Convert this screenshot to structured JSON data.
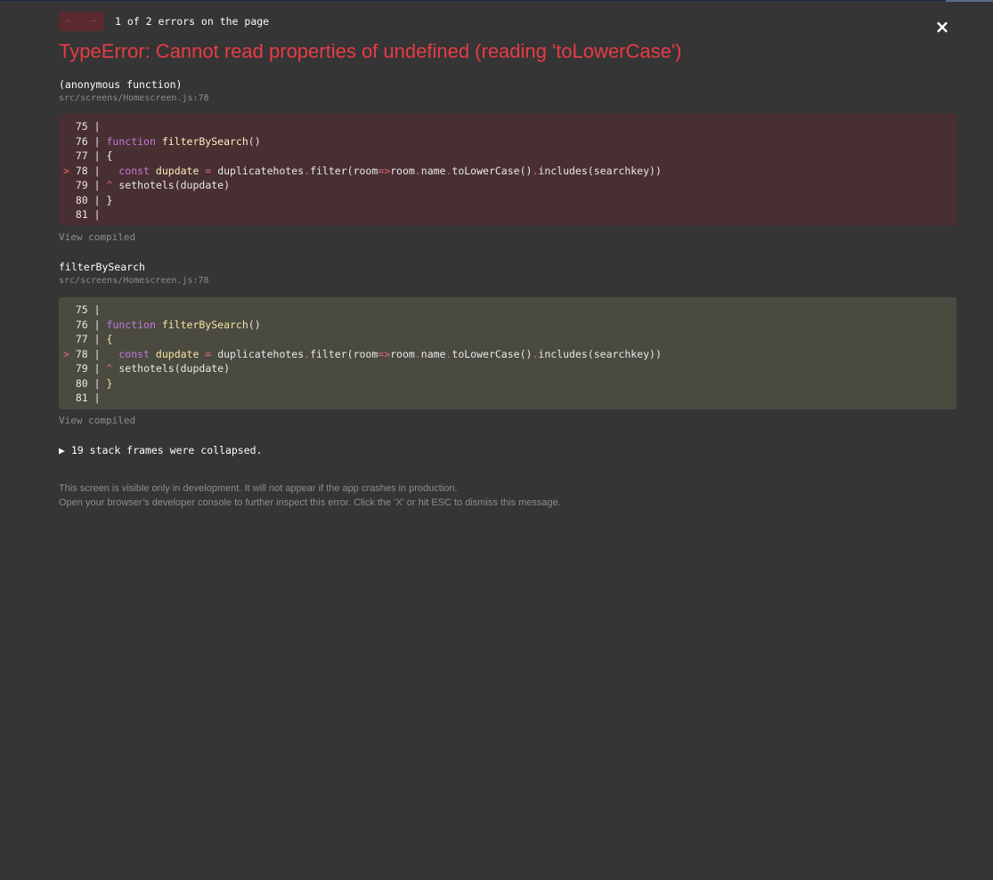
{
  "nav": {
    "prev_icon": "←",
    "next_icon": "→",
    "counter_text": "1 of 2 errors on the page"
  },
  "close": {
    "icon": "×"
  },
  "error": {
    "title": "TypeError: Cannot read properties of undefined (reading 'toLowerCase')"
  },
  "frames": [
    {
      "name": "(anonymous function)",
      "file": "src/screens/Homescreen.js:78",
      "view_compiled": "View compiled",
      "lines": [
        {
          "marker": " ",
          "number": "75",
          "code": ""
        },
        {
          "marker": " ",
          "number": "76",
          "code": "function filterBySearch()"
        },
        {
          "marker": " ",
          "number": "77",
          "code": "{"
        },
        {
          "marker": ">",
          "number": "78",
          "code": "  const dupdate = duplicatehotes.filter(room=>room.name.toLowerCase().includes(searchkey))"
        },
        {
          "marker": " ",
          "number": "79",
          "code": "^ sethotels(dupdate)"
        },
        {
          "marker": " ",
          "number": "80",
          "code": "}"
        },
        {
          "marker": " ",
          "number": "81",
          "code": ""
        }
      ]
    },
    {
      "name": "filterBySearch",
      "file": "src/screens/Homescreen.js:78",
      "view_compiled": "View compiled",
      "lines": [
        {
          "marker": " ",
          "number": "75",
          "code": ""
        },
        {
          "marker": " ",
          "number": "76",
          "code": "function filterBySearch()"
        },
        {
          "marker": " ",
          "number": "77",
          "code": "{"
        },
        {
          "marker": ">",
          "number": "78",
          "code": "  const dupdate = duplicatehotes.filter(room=>room.name.toLowerCase().includes(searchkey))"
        },
        {
          "marker": " ",
          "number": "79",
          "code": "^ sethotels(dupdate)"
        },
        {
          "marker": " ",
          "number": "80",
          "code": "}"
        },
        {
          "marker": " ",
          "number": "81",
          "code": ""
        }
      ]
    }
  ],
  "collapsed": {
    "arrow": "▶",
    "text": "19 stack frames were collapsed."
  },
  "footer": {
    "line1": "This screen is visible only in development. It will not appear if the app crashes in production.",
    "line2": "Open your browser’s developer console to further inspect this error.  Click the 'X' or hit ESC to dismiss this message."
  },
  "colors": {
    "background": "#353535",
    "error_red": "#e83b46",
    "code_bg_red": "#482f31",
    "code_bg_yellow": "#4a4a41",
    "muted_text": "#878e91"
  }
}
